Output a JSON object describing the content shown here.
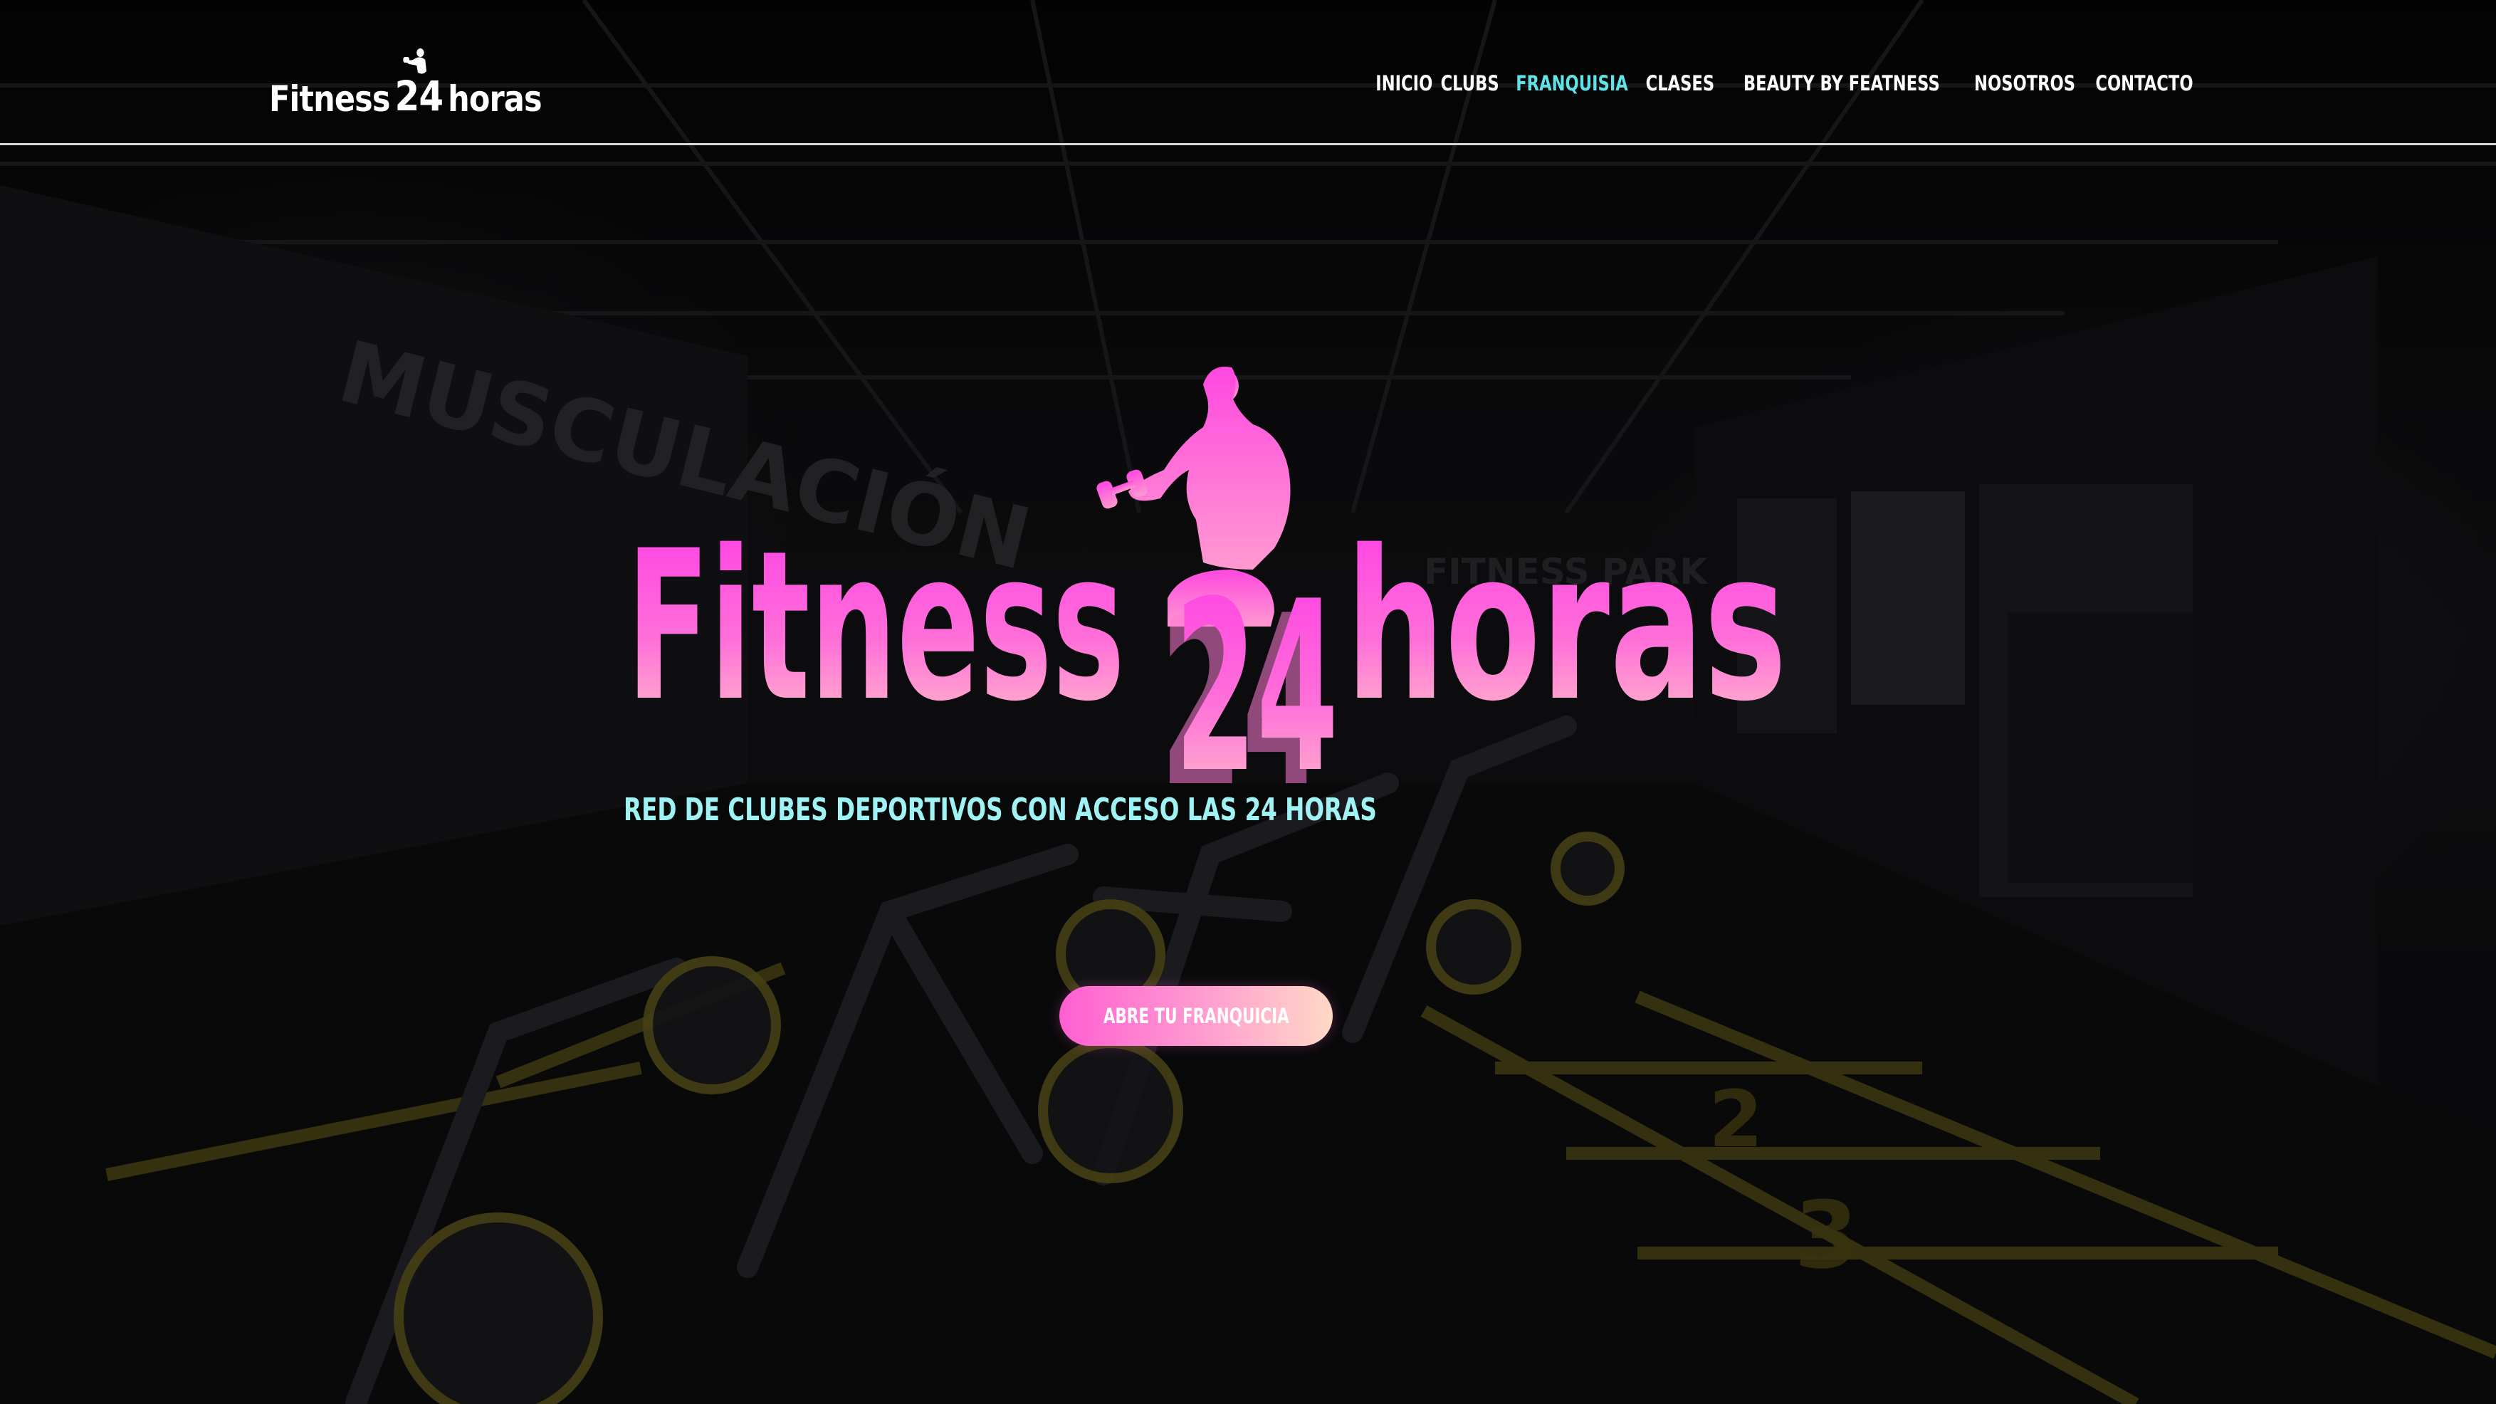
{
  "header": {
    "brand": {
      "word1": "Fitness",
      "number": "24",
      "word2": "horas"
    },
    "nav": [
      {
        "label": "INICIO",
        "active": false
      },
      {
        "label": "CLUBS",
        "active": false
      },
      {
        "label": "FRANQUISIA",
        "active": true
      },
      {
        "label": "CLASES",
        "active": false
      },
      {
        "label": "BEAUTY BY FEATNESS",
        "active": false
      },
      {
        "label": "NOSOTROS",
        "active": false
      },
      {
        "label": "CONTACTO",
        "active": false
      }
    ]
  },
  "hero": {
    "logo": {
      "word1": "Fitness",
      "number": "24",
      "word2": "horas"
    },
    "tagline": "RED DE CLUBES DEPORTIVOS CON ACCESO LAS 24 HORAS",
    "cta_label": "ABRE TU FRANQUICIA"
  },
  "colors": {
    "accent_nav": "#5fe3e6",
    "logo_gradient_top": "#ff3ce6",
    "logo_gradient_bottom": "#ffc6c8",
    "tagline": "#9ff3f4",
    "background": "#000000"
  },
  "icons": [
    "female-athlete-logo-icon",
    "dumbbell-icon"
  ]
}
